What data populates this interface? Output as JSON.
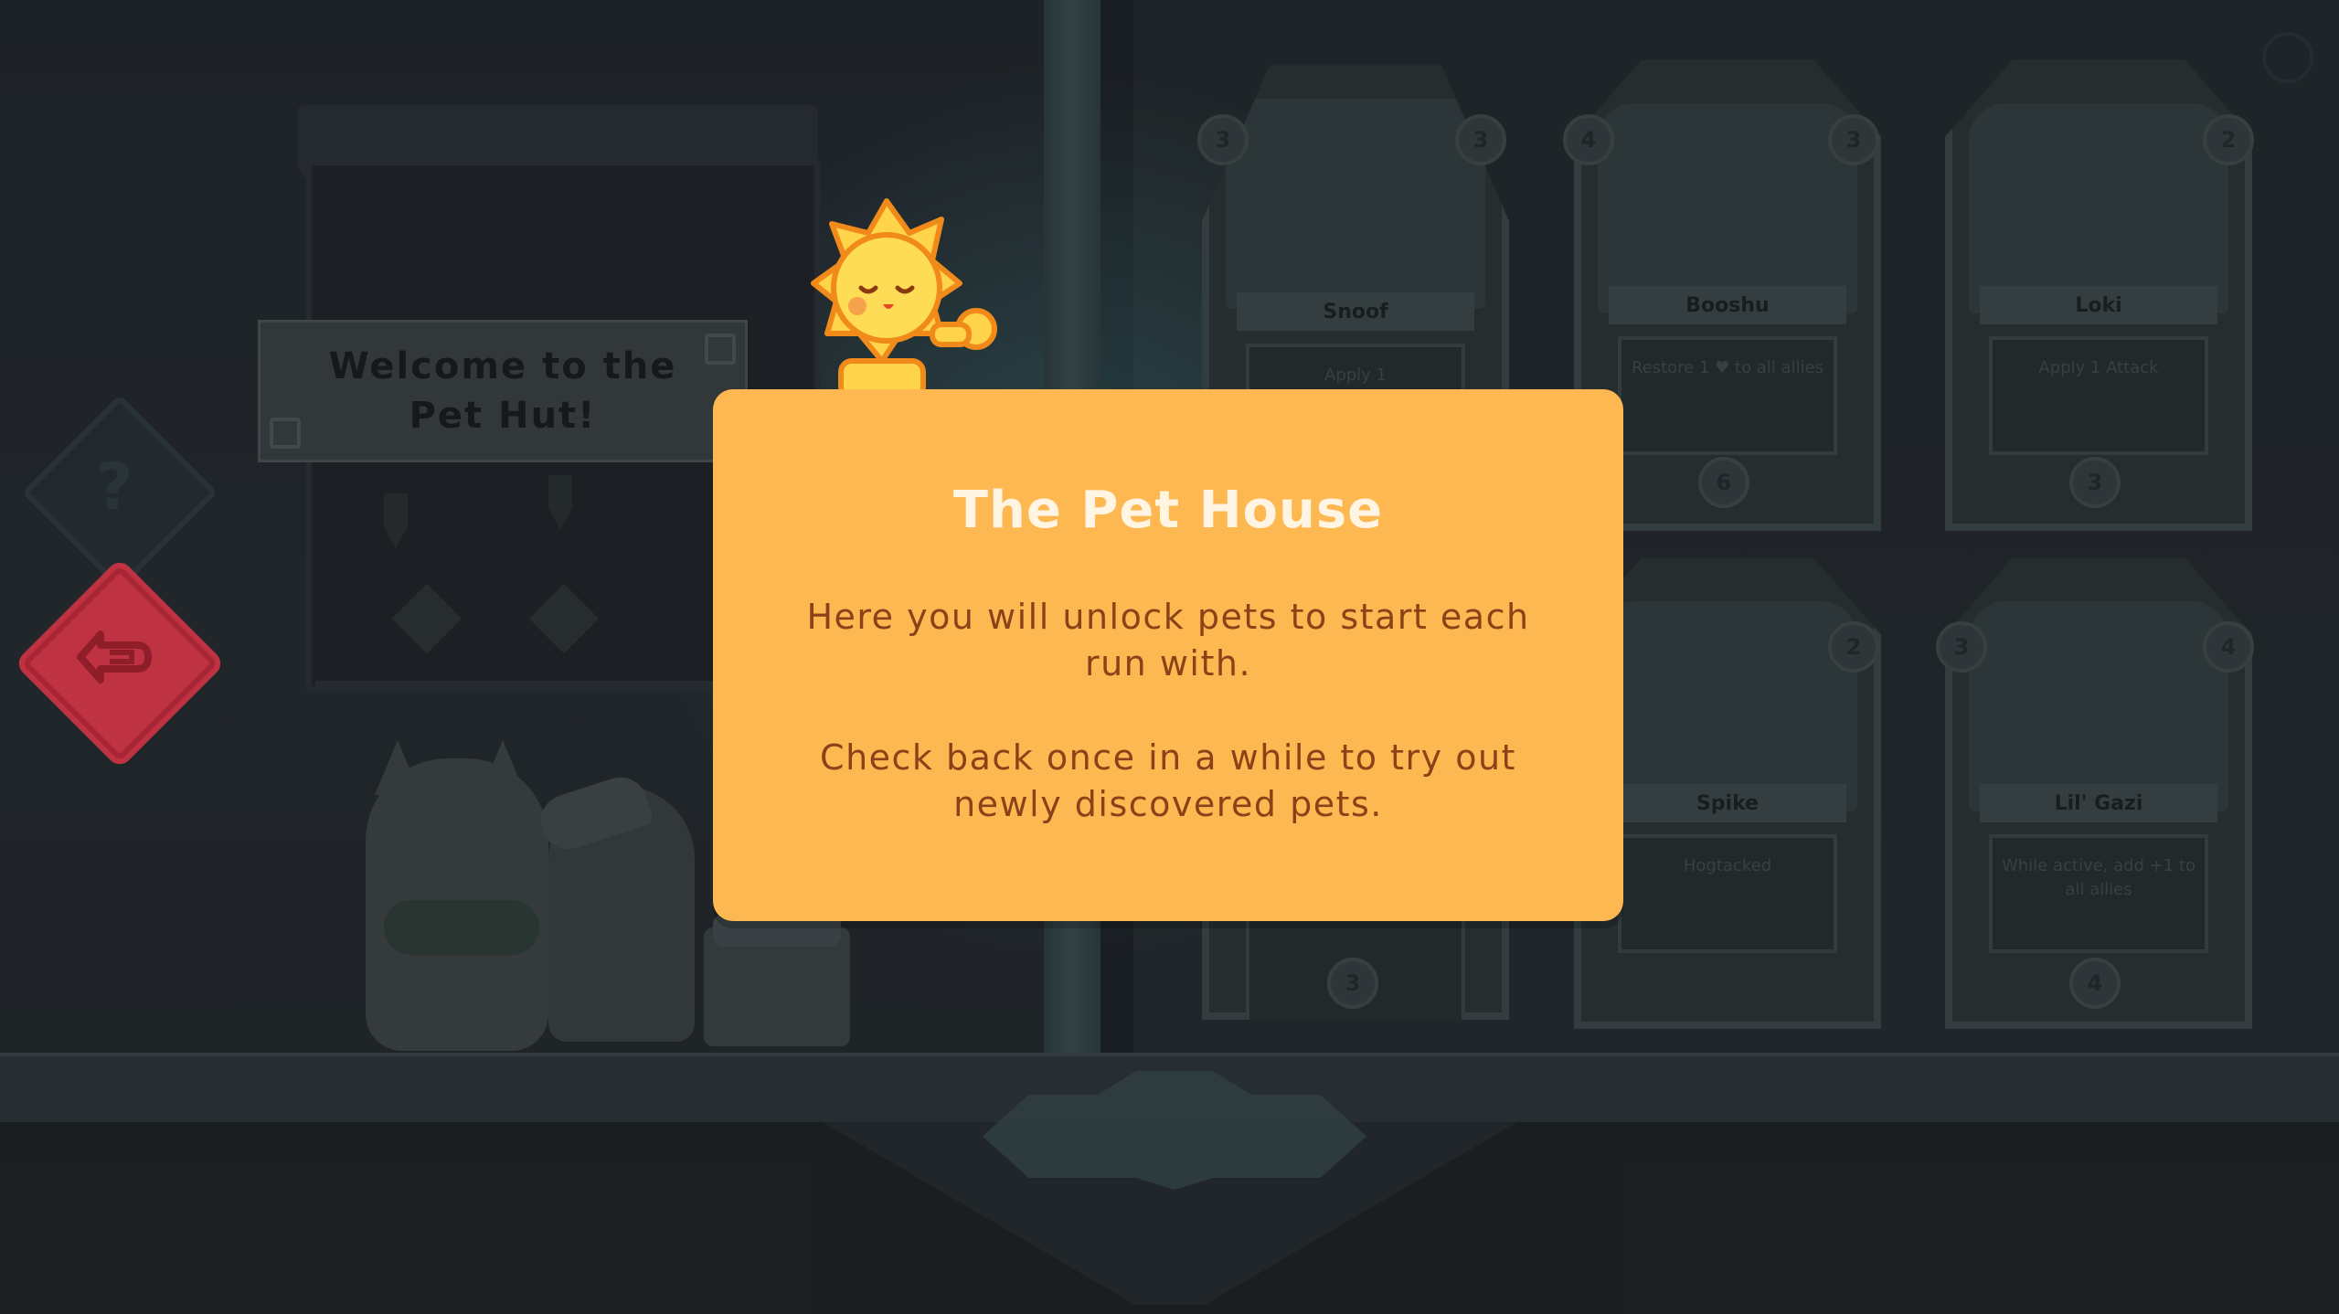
{
  "background": {
    "welcome_sign": "Welcome to the Pet Hut!",
    "help_glyph": "?",
    "cards": [
      {
        "name": "Snoof",
        "desc": "Apply 1",
        "attack": "3",
        "health": "3",
        "counter": "3"
      },
      {
        "name": "Booshu",
        "desc": "Restore 1 ♥ to all allies",
        "attack": "4",
        "health": "3",
        "counter": "6"
      },
      {
        "name": "Loki",
        "desc": "Apply 1 Attack",
        "attack": "2",
        "health": "",
        "counter": "3"
      },
      {
        "name": "Spike",
        "desc": "Hogtacked",
        "attack": "2",
        "health": "",
        "counter": ""
      },
      {
        "name": "Lil' Gazi",
        "desc": "While active, add +1 to all allies",
        "attack": "4",
        "health": "3",
        "counter": "4"
      }
    ]
  },
  "dialog": {
    "title": "The Pet House",
    "body_1": "Here you will unlock pets to start each run with.",
    "body_2": "Check back once in a while to try out newly discovered pets."
  },
  "colors": {
    "dialog_bg": "#fdb852",
    "dialog_title": "#fff5e2",
    "dialog_text": "#8a4218",
    "back_button": "#e0394b",
    "background": "#1d2126"
  },
  "icons": {
    "back_button": "back-arrow-icon",
    "help_button": "question-icon",
    "mascot": "sun-mascot-icon"
  }
}
